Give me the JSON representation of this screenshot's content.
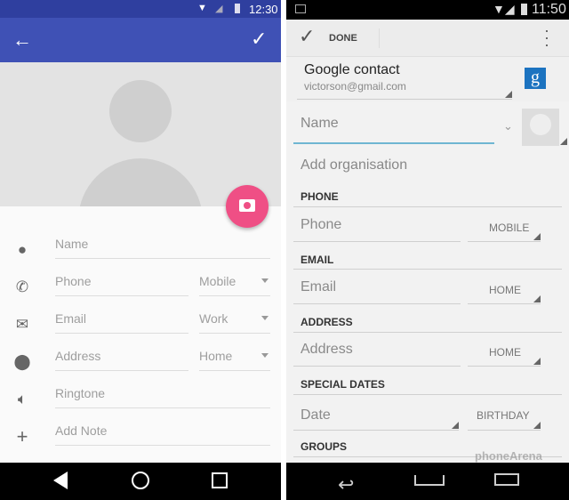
{
  "left_phone": {
    "status": {
      "time": "12:30"
    },
    "toolbar": {
      "back_icon": "arrow-left-icon",
      "save_icon": "check-icon",
      "color": "#3f51b5"
    },
    "fab": {
      "icon": "camera-icon",
      "color": "#ef4f85"
    },
    "fields": [
      {
        "icon": "person-icon",
        "placeholder": "Name"
      },
      {
        "icon": "phone-icon",
        "placeholder": "Phone",
        "type": "Mobile"
      },
      {
        "icon": "email-icon",
        "placeholder": "Email",
        "type": "Work"
      },
      {
        "icon": "location-icon",
        "placeholder": "Address",
        "type": "Home"
      },
      {
        "icon": "speaker-icon",
        "placeholder": "Ringtone"
      },
      {
        "icon": "plus-icon",
        "placeholder": "Add Note"
      }
    ]
  },
  "right_phone": {
    "status": {
      "time": "11:50"
    },
    "actionbar": {
      "done_label": "DONE"
    },
    "account": {
      "title": "Google contact",
      "email": "victorson@gmail.com"
    },
    "name_placeholder": "Name",
    "organisation_placeholder": "Add organisation",
    "sections": [
      {
        "header": "PHONE",
        "placeholder": "Phone",
        "type": "MOBILE"
      },
      {
        "header": "EMAIL",
        "placeholder": "Email",
        "type": "HOME"
      },
      {
        "header": "ADDRESS",
        "placeholder": "Address",
        "type": "HOME"
      },
      {
        "header": "SPECIAL DATES",
        "placeholder": "Date",
        "type": "BIRTHDAY"
      }
    ],
    "groups_header": "GROUPS",
    "watermark": "phoneArena"
  }
}
